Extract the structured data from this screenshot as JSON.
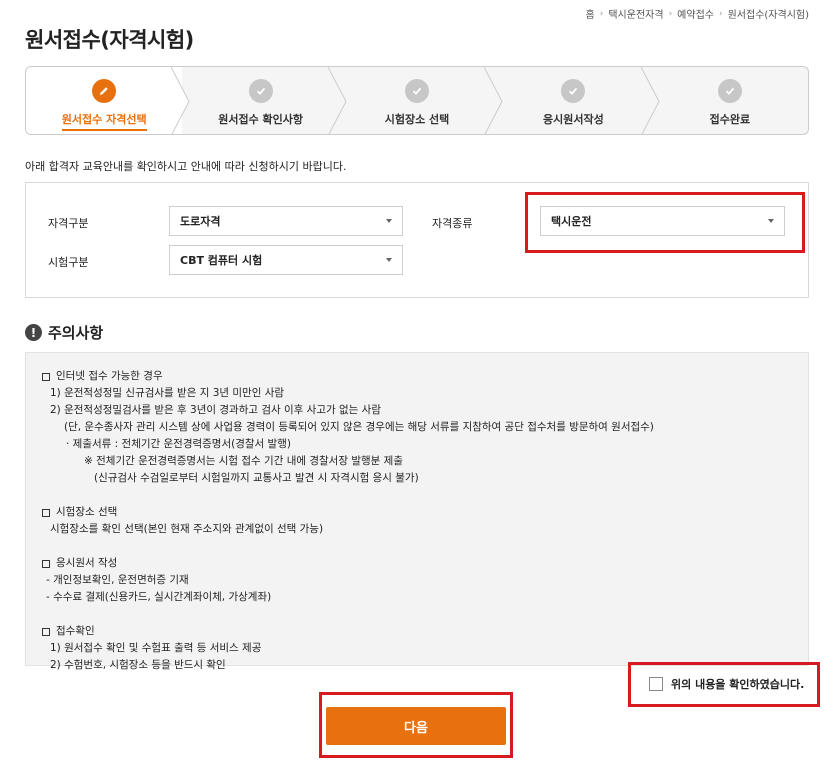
{
  "breadcrumb": [
    "홈",
    "택시운전자격",
    "예약접수",
    "원서접수(자격시험)"
  ],
  "page_title": "원서접수(자격시험)",
  "steps": [
    {
      "label": "원서접수 자격선택",
      "icon": "pencil-icon",
      "active": true
    },
    {
      "label": "원서접수 확인사항",
      "icon": "check-icon",
      "active": false
    },
    {
      "label": "시험장소 선택",
      "icon": "check-icon",
      "active": false
    },
    {
      "label": "응시원서작성",
      "icon": "check-icon",
      "active": false
    },
    {
      "label": "접수완료",
      "icon": "check-icon",
      "active": false
    }
  ],
  "instruction": "아래 합격자 교육안내를 확인하시고 안내에 따라 신청하시기 바랍니다.",
  "form": {
    "qual_category_label": "자격구분",
    "qual_category_value": "도로자격",
    "qual_type_label": "자격종류",
    "qual_type_value": "택시운전",
    "exam_category_label": "시험구분",
    "exam_category_value": "CBT 컴퓨터 시험"
  },
  "notice": {
    "title": "주의사항",
    "sections": [
      {
        "heading": "인터넷 접수 가능한 경우",
        "lines": [
          "1) 운전적성정밀 신규검사를 받은 지 3년 미만인 사람",
          "2) 운전적성정밀검사를 받은 후 3년이 경과하고 검사 이후 사고가 없는 사람",
          "(단, 운수종사자 관리 시스템 상에 사업용 경력이 등록되어 있지 않은 경우에는 해당 서류를 지참하여 공단 접수처를 방문하여 원서접수)",
          "· 제출서류 : 전체기간 운전경력증명서(경찰서 발행)",
          "※ 전체기간 운전경력증명서는 시험 접수 기간 내에 경찰서장 발행분 제출",
          "(신규검사 수검일로부터 시험일까지 교통사고 발견 시 자격시험 응시 불가)"
        ]
      },
      {
        "heading": "시험장소 선택",
        "lines": [
          "시험장소를 확인 선택(본인 현재 주소지와 관계없이 선택 가능)"
        ]
      },
      {
        "heading": "응시원서 작성",
        "lines": [
          "- 개인정보확인, 운전면허증 기재",
          "- 수수료 결제(신용카드, 실시간계좌이체, 가상계좌)"
        ]
      },
      {
        "heading": "접수확인",
        "lines": [
          "1) 원서접수 확인 및 수험표 출력 등 서비스 제공",
          "2) 수험번호, 시험장소 등을 반드시 확인"
        ]
      }
    ]
  },
  "confirm_label": "위의 내용을 확인하였습니다.",
  "next_button": "다음",
  "colors": {
    "accent": "#e8710f",
    "highlight": "#d71920"
  }
}
